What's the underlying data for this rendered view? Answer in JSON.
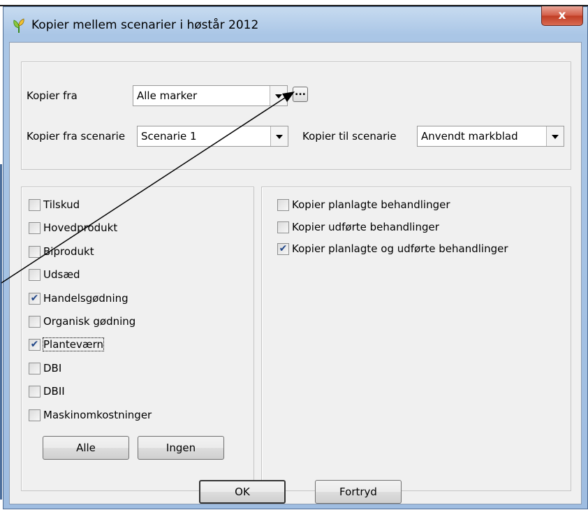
{
  "window": {
    "title": "Kopier mellem scenarier i høstår 2012",
    "close_label": "x"
  },
  "source": {
    "kopier_fra_label": "Kopier fra",
    "kopier_fra_value": "Alle marker",
    "ellipsis_label": "...",
    "fra_scenarie_label": "Kopier fra scenarie",
    "fra_scenarie_value": "Scenarie 1",
    "til_scenarie_label": "Kopier til scenarie",
    "til_scenarie_value": "Anvendt markblad"
  },
  "categories": [
    {
      "label": "Tilskud",
      "checked": false
    },
    {
      "label": "Hovedprodukt",
      "checked": false
    },
    {
      "label": "Biprodukt",
      "checked": false
    },
    {
      "label": "Udsæd",
      "checked": false
    },
    {
      "label": "Handelsgødning",
      "checked": true
    },
    {
      "label": "Organisk gødning",
      "checked": false
    },
    {
      "label": "Planteværn",
      "checked": true
    },
    {
      "label": "DBI",
      "checked": false
    },
    {
      "label": "DBII",
      "checked": false
    },
    {
      "label": "Maskinomkostninger",
      "checked": false
    }
  ],
  "select_buttons": {
    "all_label": "Alle",
    "none_label": "Ingen"
  },
  "treatments": [
    {
      "label": "Kopier planlagte behandlinger",
      "checked": false
    },
    {
      "label": "Kopier udførte behandlinger",
      "checked": false
    },
    {
      "label": "Kopier planlagte og udførte behandlinger",
      "checked": true
    }
  ],
  "footer": {
    "ok_label": "OK",
    "cancel_label": "Fortryd"
  },
  "colors": {
    "title_bar": "#aac6e6",
    "close_button": "#c03d24",
    "dialog_bg": "#f0f0f0",
    "check_mark": "#224788"
  },
  "icons": {
    "app": "green-leaf-icon",
    "close": "close-icon",
    "dropdown": "chevron-down-icon",
    "annotation": "arrow-annotation"
  }
}
